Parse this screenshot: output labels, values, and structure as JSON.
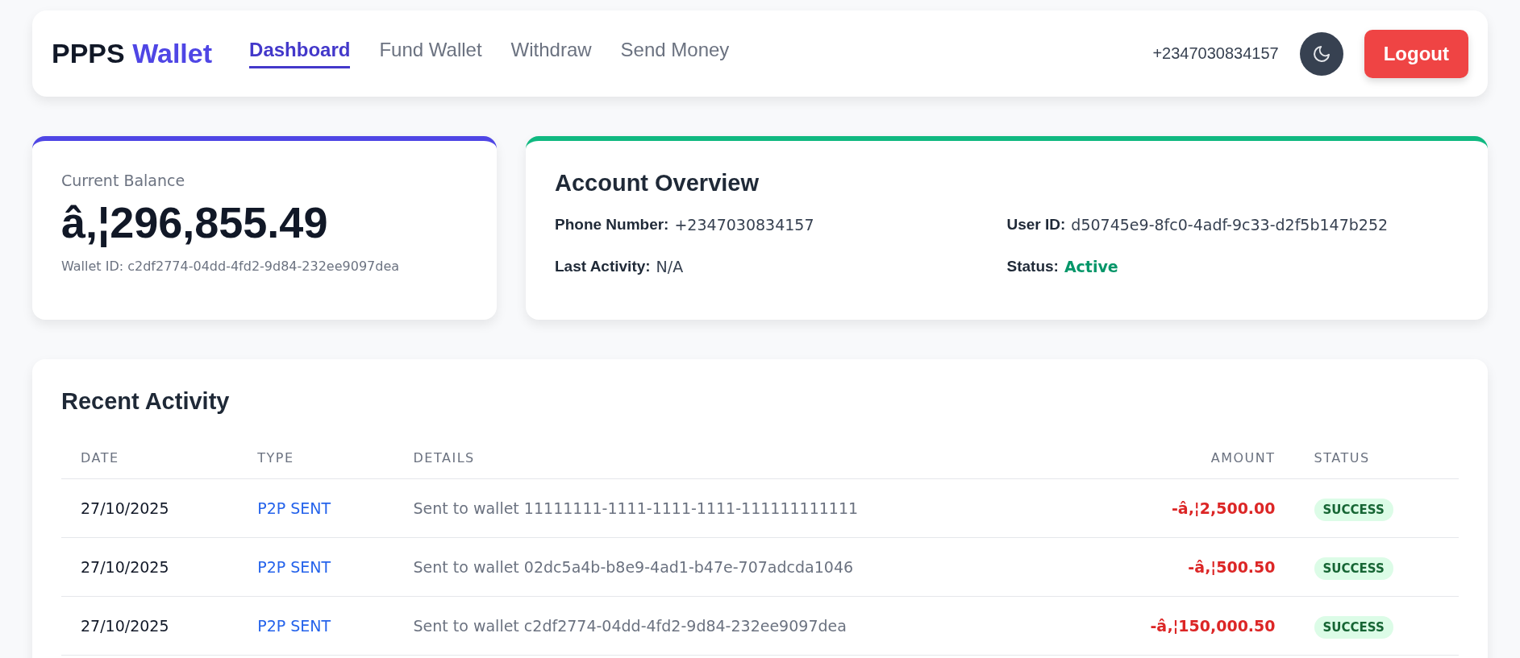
{
  "header": {
    "logo": {
      "name": "PPPS",
      "accent": "Wallet"
    },
    "nav": [
      {
        "label": "Dashboard",
        "selected": true
      },
      {
        "label": "Fund Wallet",
        "selected": false
      },
      {
        "label": "Withdraw",
        "selected": false
      },
      {
        "label": "Send Money",
        "selected": false
      }
    ],
    "phone": "+2347030834157",
    "logout": "Logout"
  },
  "balance": {
    "label": "Current Balance",
    "amount": "â‚¦296,855.49",
    "wallet_id": "Wallet ID: c2df2774-04dd-4fd2-9d84-232ee9097dea"
  },
  "overview": {
    "title": "Account Overview",
    "fields": [
      {
        "label": "Phone Number:",
        "value": "+2347030834157",
        "kind": "text"
      },
      {
        "label": "User ID:",
        "value": "d50745e9-8fc0-4adf-9c33-d2f5b147b252",
        "kind": "text"
      },
      {
        "label": "Last Activity:",
        "value": "N/A",
        "kind": "text"
      },
      {
        "label": "Status:",
        "value": "Active",
        "kind": "status"
      }
    ]
  },
  "activity": {
    "title": "Recent Activity",
    "columns": [
      "DATE",
      "TYPE",
      "DETAILS",
      "AMOUNT",
      "STATUS"
    ],
    "rows": [
      {
        "date": "27/10/2025",
        "type": "P2P SENT",
        "details": "Sent to wallet 11111111-1111-1111-1111-111111111111",
        "amount": "-â‚¦2,500.00",
        "status": "SUCCESS"
      },
      {
        "date": "27/10/2025",
        "type": "P2P SENT",
        "details": "Sent to wallet 02dc5a4b-b8e9-4ad1-b47e-707adcda1046",
        "amount": "-â‚¦500.50",
        "status": "SUCCESS"
      },
      {
        "date": "27/10/2025",
        "type": "P2P SENT",
        "details": "Sent to wallet c2df2774-04dd-4fd2-9d84-232ee9097dea",
        "amount": "-â‚¦150,000.50",
        "status": "SUCCESS"
      }
    ]
  }
}
